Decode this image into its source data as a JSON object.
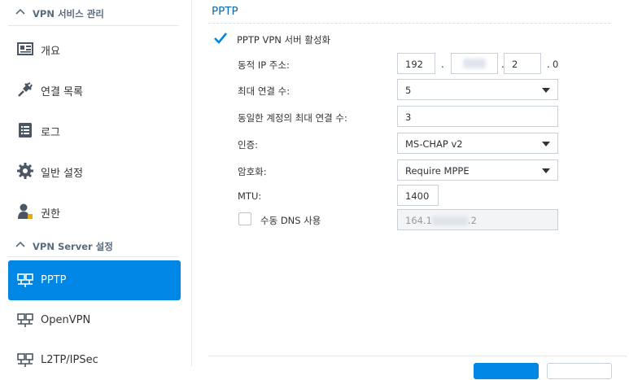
{
  "sidebar": {
    "section1_title": "VPN 서비스 관리",
    "section2_title": "VPN Server 설정",
    "items": [
      {
        "label": "개요"
      },
      {
        "label": "연결 목록"
      },
      {
        "label": "로그"
      },
      {
        "label": "일반 설정"
      },
      {
        "label": "권한"
      },
      {
        "label": "PPTP"
      },
      {
        "label": "OpenVPN"
      },
      {
        "label": "L2TP/IPSec"
      }
    ],
    "active": "PPTP"
  },
  "main": {
    "title": "PPTP",
    "enable_label": "PPTP VPN 서버 활성화",
    "enable_checked": true,
    "fields": {
      "dynamic_ip": {
        "label": "동적 IP 주소:",
        "octet1": "192",
        "octet2": "",
        "octet3": "2",
        "octet4": "0"
      },
      "max_conn": {
        "label": "최대 연결 수:",
        "value": "5"
      },
      "max_same_account": {
        "label": "동일한 계정의 최대 연결 수:",
        "value": "3"
      },
      "auth": {
        "label": "인증:",
        "value": "MS-CHAP v2"
      },
      "encryption": {
        "label": "암호화:",
        "value": "Require MPPE"
      },
      "mtu": {
        "label": "MTU:",
        "value": "1400"
      },
      "manual_dns": {
        "label": "수동 DNS 사용",
        "checked": false,
        "value_prefix": "164.1",
        "value_suffix": ".2"
      }
    }
  },
  "colors": {
    "accent": "#0086e5",
    "title": "#0b6ab3"
  }
}
